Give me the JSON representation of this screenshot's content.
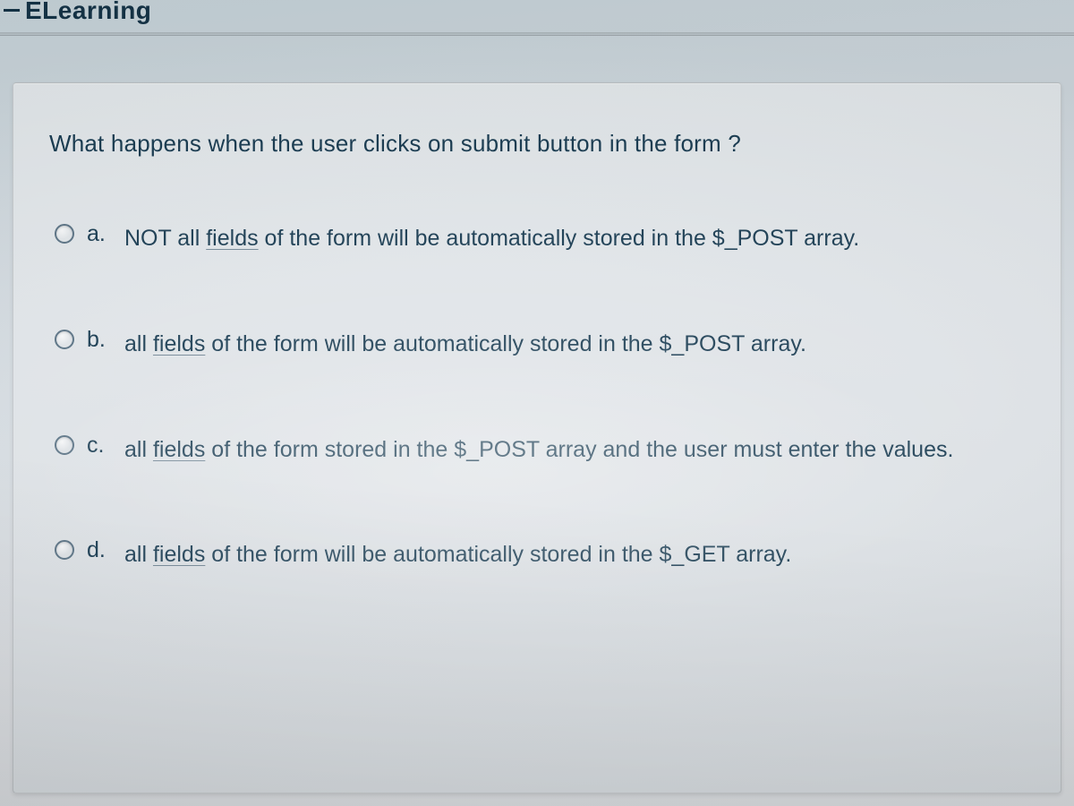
{
  "brand": "ELearning",
  "question": "What happens when the user clicks on submit button in the form ?",
  "underline_word": "fields",
  "options": [
    {
      "letter": "a.",
      "pre": "NOT all ",
      "post": " of the form will be automatically stored in the $_POST array."
    },
    {
      "letter": "b.",
      "pre": "all ",
      "post": " of the form will be automatically stored in the $_POST array."
    },
    {
      "letter": "c.",
      "pre": "all ",
      "post": " of the form  stored in the $_POST array and the user must enter the values."
    },
    {
      "letter": "d.",
      "pre": "all ",
      "post": " of the form will be automatically stored in the $_GET array."
    }
  ]
}
